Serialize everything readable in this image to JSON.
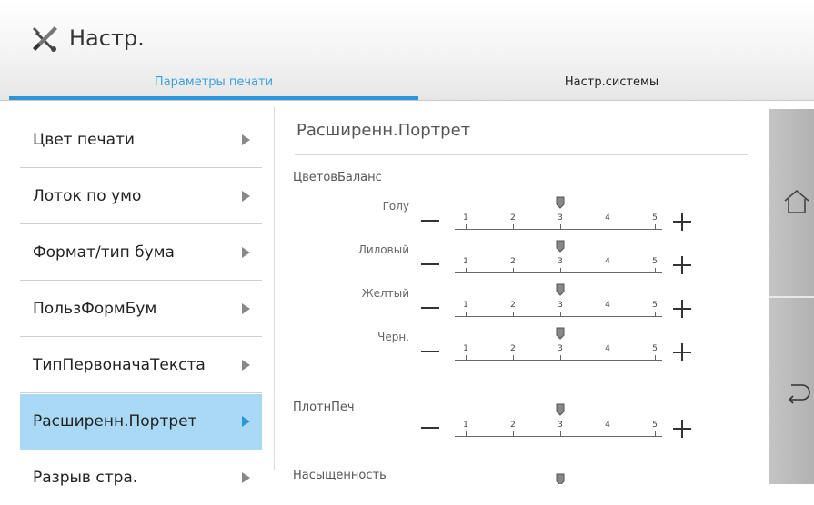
{
  "header": {
    "title": "Настр.",
    "tabs": [
      {
        "label": "Параметры печати",
        "active": true
      },
      {
        "label": "Настр.системы",
        "active": false
      }
    ]
  },
  "menu": {
    "items": [
      {
        "label": "Цвет печати"
      },
      {
        "label": "Лоток по умо"
      },
      {
        "label": "Формат/тип бума"
      },
      {
        "label": "ПользФормБум"
      },
      {
        "label": "ТипПервоначаТекста"
      },
      {
        "label": "Расширенн.Портрет",
        "selected": true
      },
      {
        "label": "Разрыв стра."
      }
    ]
  },
  "content": {
    "title": "Расширенн.Портрет",
    "color_balance": {
      "label": "ЦветовБаланс",
      "sliders": [
        {
          "label": "Голу",
          "value": 3
        },
        {
          "label": "Лиловый",
          "value": 3
        },
        {
          "label": "Желтый",
          "value": 3
        },
        {
          "label": "Черн.",
          "value": 3
        }
      ]
    },
    "density": {
      "label": "ПлотнПеч",
      "value": 3
    },
    "saturation": {
      "label": "Насыщенность",
      "value": 3
    },
    "scale_ticks": [
      "1",
      "2",
      "3",
      "4",
      "5"
    ]
  },
  "colors": {
    "accent": "#2b96d8",
    "selected_bg": "#a9d9f5",
    "side_bar": "#b8b8b8"
  },
  "icons": {
    "title": "tools-icon",
    "side_top": "home-icon",
    "side_bottom": "back-icon"
  }
}
